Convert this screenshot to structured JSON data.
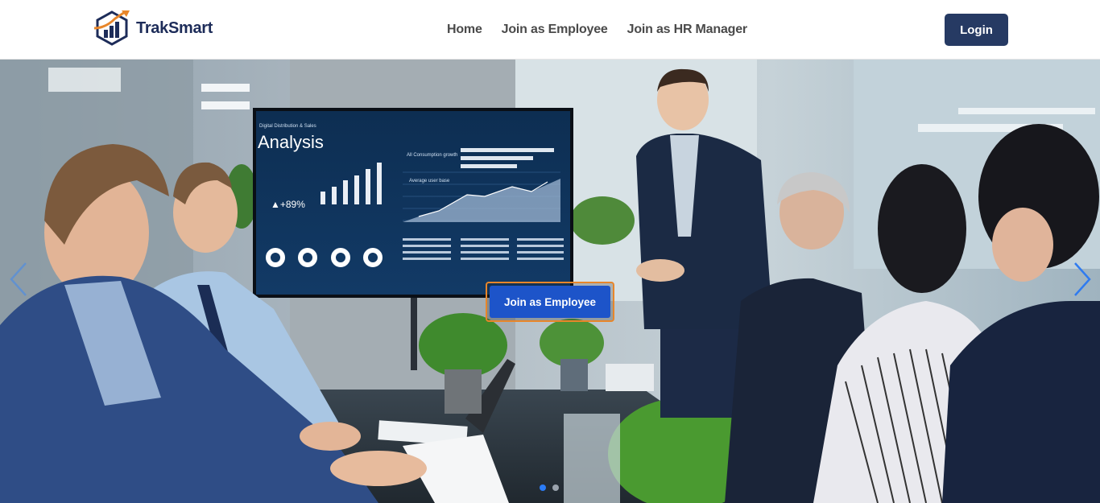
{
  "header": {
    "brand_name": "TrakSmart",
    "nav": {
      "home": "Home",
      "join_employee": "Join as Employee",
      "join_hr": "Join as HR Manager"
    },
    "login_label": "Login"
  },
  "hero": {
    "cta_label": "Join as Employee",
    "screen": {
      "subtitle": "Digital Distribution & Sales",
      "title": "Analysis",
      "growth": "▲+89%",
      "chart_title": "All Consumption growth",
      "average_label": "Average user base"
    },
    "carousel": {
      "slide_count": 2,
      "active_index": 0
    }
  },
  "colors": {
    "brand_navy": "#1d2c59",
    "login_bg": "#263a63",
    "cta_bg": "#1d54c9",
    "cta_border": "#e8862a",
    "dot_active": "#2b7cf6"
  },
  "icons": [
    "brand-logo-icon",
    "chevron-left-icon",
    "chevron-right-icon"
  ]
}
